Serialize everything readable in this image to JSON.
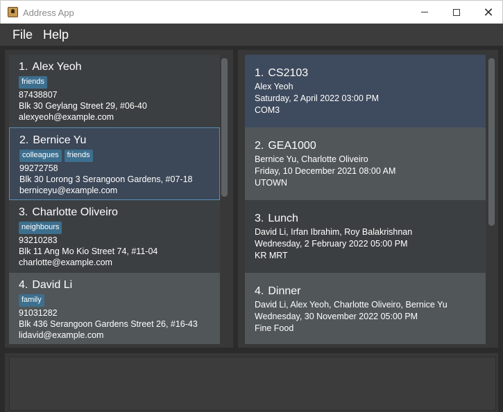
{
  "window": {
    "title": "Address App",
    "minimize_icon": "minimize-icon",
    "maximize_icon": "maximize-icon",
    "close_icon": "close-icon"
  },
  "menu": {
    "file": "File",
    "help": "Help"
  },
  "persons": [
    {
      "index": "1.",
      "name": "Alex Yeoh",
      "tags": [
        "friends"
      ],
      "phone": "87438807",
      "address": "Blk 30 Geylang Street 29, #06-40",
      "email": "alexyeoh@example.com"
    },
    {
      "index": "2.",
      "name": "Bernice Yu",
      "tags": [
        "colleagues",
        "friends"
      ],
      "phone": "99272758",
      "address": "Blk 30 Lorong 3 Serangoon Gardens, #07-18",
      "email": "berniceyu@example.com"
    },
    {
      "index": "3.",
      "name": "Charlotte Oliveiro",
      "tags": [
        "neighbours"
      ],
      "phone": "93210283",
      "address": "Blk 11 Ang Mo Kio Street 74, #11-04",
      "email": "charlotte@example.com"
    },
    {
      "index": "4.",
      "name": "David Li",
      "tags": [
        "family"
      ],
      "phone": "91031282",
      "address": "Blk 436 Serangoon Gardens Street 26, #16-43",
      "email": "lidavid@example.com"
    }
  ],
  "events": [
    {
      "index": "1.",
      "name": "CS2103",
      "people": "Alex Yeoh",
      "datetime": "Saturday, 2 April 2022 03:00 PM",
      "location": "COM3"
    },
    {
      "index": "2.",
      "name": "GEA1000",
      "people": "Bernice Yu, Charlotte Oliveiro",
      "datetime": "Friday, 10 December 2021 08:00 AM",
      "location": "UTOWN"
    },
    {
      "index": "3.",
      "name": "Lunch",
      "people": "David Li, Irfan Ibrahim, Roy Balakrishnan",
      "datetime": "Wednesday, 2 February 2022 05:00 PM",
      "location": "KR MRT"
    },
    {
      "index": "4.",
      "name": "Dinner",
      "people": "David Li, Alex Yeoh, Charlotte Oliveiro, Bernice Yu",
      "datetime": "Wednesday, 30 November 2022 05:00 PM",
      "location": "Fine Food"
    }
  ],
  "colors": {
    "background": "#2b2b2b",
    "tag": "#3d6f8e",
    "selected_border": "#5b8fb8"
  }
}
